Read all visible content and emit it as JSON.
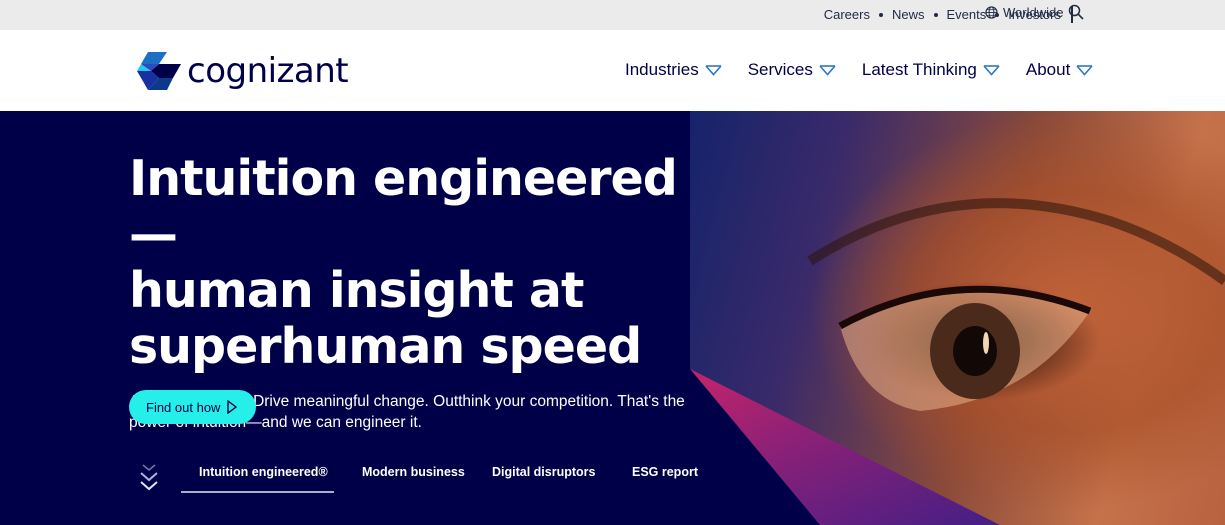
{
  "utility_bar": {
    "links": [
      "Careers",
      "News",
      "Events",
      "Investors"
    ],
    "region_label": "Worldwide"
  },
  "header": {
    "brand": "cognizant",
    "nav": [
      "Industries",
      "Services",
      "Latest Thinking",
      "About"
    ]
  },
  "hero": {
    "title_lines": [
      "Intuition engineered—",
      "human insight at",
      "superhuman speed"
    ],
    "subtitle": "Anticipate trends. Drive meaningful change. Outthink your competition. That's the power of intuition—and we can engineer it.",
    "cta_label": "Find out how",
    "tabs": [
      "Intuition engineered®",
      "Modern business",
      "Digital disruptors",
      "ESG report"
    ],
    "active_tab_index": 0
  },
  "colors": {
    "navy": "#000048",
    "accent_teal": "#26efe9",
    "utility_bg": "#ebebeb",
    "nav_chevron": "#2f78c4"
  },
  "icons": [
    "globe-icon",
    "search-icon",
    "chevron-down-icon",
    "play-icon",
    "scroll-down-icon",
    "cognizant-logo-icon"
  ]
}
